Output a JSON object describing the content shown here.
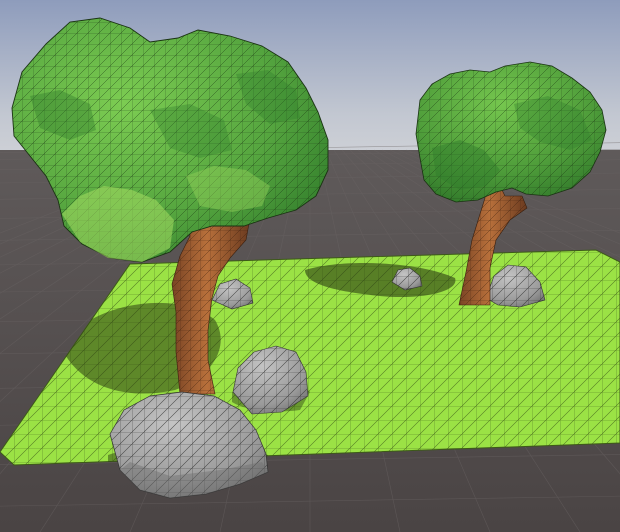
{
  "viewport": {
    "mode": "3D scene view",
    "show_wireframe": true,
    "show_ground_grid": true
  },
  "colors": {
    "sky_top": "#9aa7c2",
    "sky_horizon": "#c9cdd4",
    "floor": "#4e4848",
    "floor_grid_line": "#5d5858",
    "terrain": "#9ee046",
    "terrain_shade": "#84c23a",
    "terrain_wire": "#4b6a1e",
    "foliage_light": "#6cc04a",
    "foliage_dark": "#2f7a2a",
    "foliage_mid": "#4f9f3c",
    "trunk_light": "#b36a37",
    "trunk_dark": "#6e3d20",
    "rock_light": "#b9b9b9",
    "rock_dark": "#7c7c7c",
    "shadow": "#2a3a10",
    "wire": "#1f1f1f"
  },
  "scene": {
    "terrain_plane": {
      "name": "grass-terrain",
      "material": "grass"
    },
    "trees": [
      {
        "name": "tree-large-front",
        "type": "lowpoly-tree"
      },
      {
        "name": "tree-small-back",
        "type": "lowpoly-tree"
      }
    ],
    "rocks": [
      {
        "name": "rock-large-front",
        "type": "lowpoly-rock"
      },
      {
        "name": "rock-medium-center",
        "type": "lowpoly-rock"
      },
      {
        "name": "rock-small-behind-trunk",
        "type": "lowpoly-rock"
      },
      {
        "name": "rock-small-back-left",
        "type": "lowpoly-rock"
      },
      {
        "name": "rock-medium-back-right",
        "type": "lowpoly-rock"
      }
    ]
  }
}
